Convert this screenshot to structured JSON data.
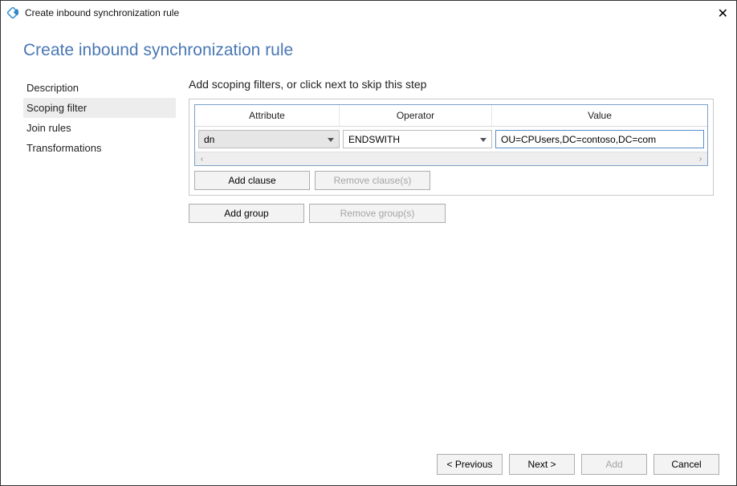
{
  "window": {
    "title": "Create inbound synchronization rule",
    "close_glyph": "✕"
  },
  "page": {
    "heading": "Create inbound synchronization rule"
  },
  "nav": {
    "items": [
      {
        "label": "Description",
        "active": false
      },
      {
        "label": "Scoping filter",
        "active": true
      },
      {
        "label": "Join rules",
        "active": false
      },
      {
        "label": "Transformations",
        "active": false
      }
    ]
  },
  "main": {
    "instruction": "Add scoping filters, or click next to skip this step",
    "grid": {
      "columns": {
        "attribute": "Attribute",
        "operator": "Operator",
        "value": "Value"
      },
      "rows": [
        {
          "attribute": "dn",
          "operator": "ENDSWITH",
          "value": "OU=CPUsers,DC=contoso,DC=com"
        }
      ]
    },
    "buttons": {
      "add_clause": "Add clause",
      "remove_clause": "Remove clause(s)",
      "add_group": "Add group",
      "remove_group": "Remove group(s)"
    },
    "scroll_left": "‹",
    "scroll_right": "›"
  },
  "footer": {
    "previous": "< Previous",
    "next": "Next >",
    "add": "Add",
    "cancel": "Cancel"
  }
}
